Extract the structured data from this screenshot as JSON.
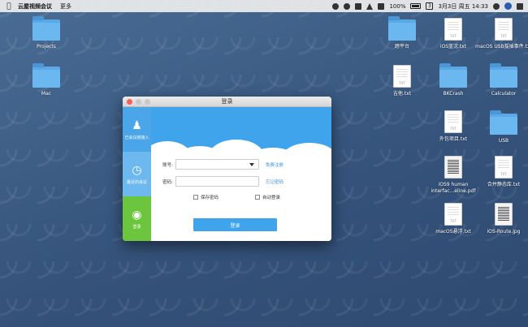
{
  "menubar": {
    "app_name": "云屋视频会议",
    "menus": [
      "更多"
    ],
    "battery": "100%",
    "date_time": "3月3日 周五 14:33",
    "badge": "3"
  },
  "desktop": [
    {
      "name": "Projects",
      "type": "folder"
    },
    {
      "name": "Mac",
      "type": "folder"
    },
    {
      "name": "跨平台",
      "type": "folder"
    },
    {
      "name": "iOS蓝沈.txt",
      "type": "doc"
    },
    {
      "name": "macOS USB拔插事件.txt",
      "type": "doc"
    },
    {
      "name": "吉他.txt",
      "type": "doc"
    },
    {
      "name": "BKCrash",
      "type": "folder"
    },
    {
      "name": "Calculator",
      "type": "folder"
    },
    {
      "name": "外包项目.txt",
      "type": "doc"
    },
    {
      "name": "USB",
      "type": "folder"
    },
    {
      "name": "iOS9 human interfac...eline.pdf",
      "type": "doc"
    },
    {
      "name": "合并静态库.txt",
      "type": "doc"
    },
    {
      "name": "macOS悬浮.txt",
      "type": "doc"
    },
    {
      "name": "iOS-Route.jpg",
      "type": "doc"
    }
  ],
  "window": {
    "title": "登录",
    "sidebar": [
      {
        "label": "已会议链接入",
        "icon": "meeting-icon"
      },
      {
        "label": "最近的会议",
        "icon": "clock-icon"
      },
      {
        "label": "登录",
        "icon": "user-icon"
      }
    ],
    "account_label": "账号:",
    "account_value": "",
    "register_link": "免费注册",
    "password_label": "密码:",
    "password_value": "",
    "forgot_link": "忘记密码",
    "save_password": "保存密码",
    "auto_login": "自动登录",
    "login_button": "登录"
  }
}
